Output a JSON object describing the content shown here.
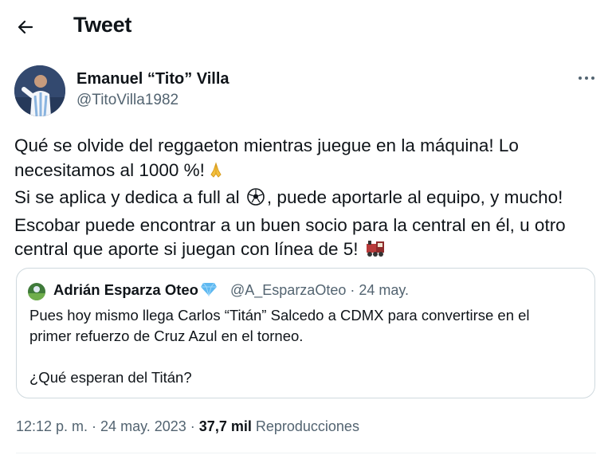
{
  "header": {
    "title": "Tweet",
    "back_icon": "arrow-left-icon"
  },
  "tweet": {
    "author_name": "Emanuel “Tito” Villa",
    "author_handle": "@TitoVilla1982",
    "more_icon": "ellipsis-icon",
    "text": {
      "line1": "Qué se olvide del reggaeton mientras juegue en la máquina! Lo",
      "line2": "necesitamos al 1000 %!",
      "line3a": "Si se aplica y dedica a full al",
      "line3b": ", puede aportarle al equipo, y mucho!",
      "line4": "Escobar puede encontrar a un buen socio para la central en él, u otro",
      "line5": "central que aporte si juegan con línea de 5!"
    },
    "emojis": [
      "folded-hands-icon",
      "soccer-ball-icon",
      "train-icon"
    ],
    "timestamp": "12:12 p. m. · 24 may. 2023 ·",
    "views_count": "37,7 mil",
    "views_label": "Reproducciones"
  },
  "quote": {
    "author_name": "Adrián Esparza Oteo",
    "badge_icon": "blue-diamond-icon",
    "author_handle": "@A_EsparzaOteo",
    "date": "· 24 may.",
    "text": {
      "line1": "Pues hoy mismo llega Carlos “Titán” Salcedo a CDMX para convertirse en el",
      "line2": "primer refuerzo de Cruz Azul en el torneo.",
      "line3": "¿Qué esperan del Titán?"
    }
  },
  "colors": {
    "text": "#0f1419",
    "secondary": "#536471",
    "border": "#cfd9de"
  }
}
